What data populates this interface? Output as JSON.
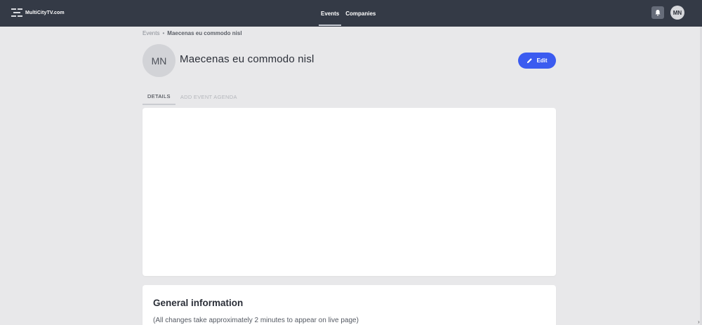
{
  "brand": {
    "name": "MultiCityTV.com"
  },
  "nav": {
    "items": [
      {
        "label": "Events",
        "active": true
      },
      {
        "label": "Companies",
        "active": false
      }
    ]
  },
  "header": {
    "bell_icon": "bell-icon",
    "user_initials": "MN"
  },
  "breadcrumb": {
    "parent": "Events",
    "separator": "•",
    "current": "Maecenas eu commodo nisl"
  },
  "event": {
    "initials": "MN",
    "title": "Maecenas eu commodo nisl"
  },
  "edit_button": {
    "label": "Edit",
    "icon": "pencil-icon",
    "color": "#3b5bf0"
  },
  "tabs": [
    {
      "label": "DETAILS",
      "active": true
    },
    {
      "label": "ADD EVENT AGENDA",
      "active": false
    }
  ],
  "general": {
    "title": "General information",
    "note": "(All changes take approximately 2 minutes to appear on live page)"
  },
  "colors": {
    "topbar": "#343a46",
    "background": "#e8e8ea",
    "card": "#ffffff"
  }
}
